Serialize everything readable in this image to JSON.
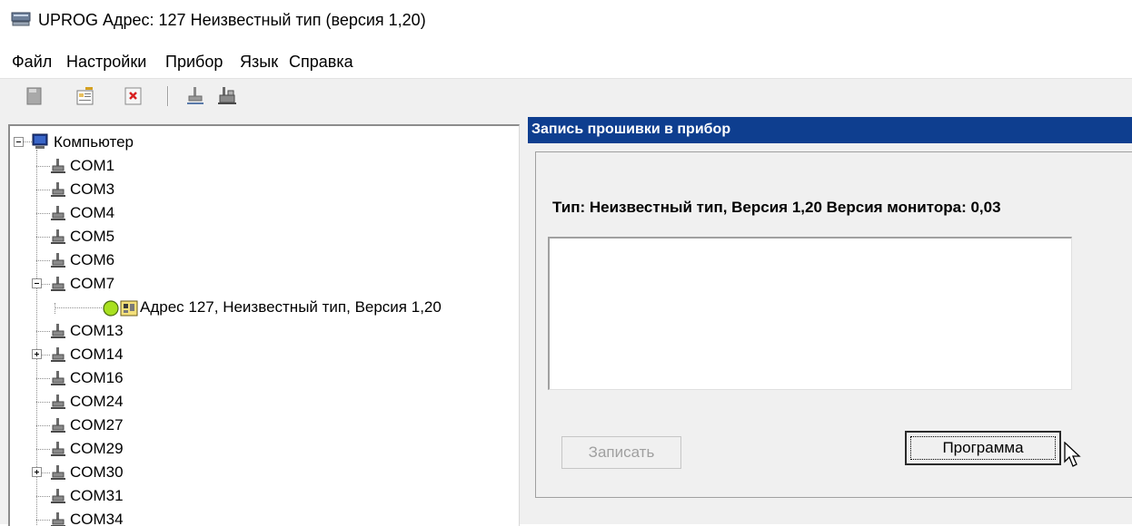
{
  "window": {
    "title": "UPROG  Адрес: 127  Неизвестный тип (версия  1,20)"
  },
  "menu": {
    "items": [
      "Файл",
      "Настройки",
      "Прибор",
      "Язык",
      "Справка"
    ]
  },
  "toolbar": {
    "buttons": [
      "save-icon",
      "properties-icon",
      "delete-icon",
      "port-icon",
      "port-config-icon"
    ]
  },
  "tree": {
    "root": "Компьютер",
    "ports": [
      "COM1",
      "COM3",
      "COM4",
      "COM5",
      "COM6",
      "COM7",
      "COM13",
      "COM14",
      "COM16",
      "COM24",
      "COM27",
      "COM29",
      "COM30",
      "COM31",
      "COM34"
    ],
    "device_node": "Адрес 127, Неизвестный тип, Версия 1,20"
  },
  "panel": {
    "header": "Запись прошивки в прибор",
    "type_info": "Тип: Неизвестный тип, Версия 1,20 Версия монитора: 0,03",
    "log_text": "",
    "write_button": "Записать",
    "program_button": "Программа"
  },
  "colors": {
    "header_bg": "#0e3e8f",
    "header_text": "#ffffff",
    "status_green": "#a8e020"
  }
}
